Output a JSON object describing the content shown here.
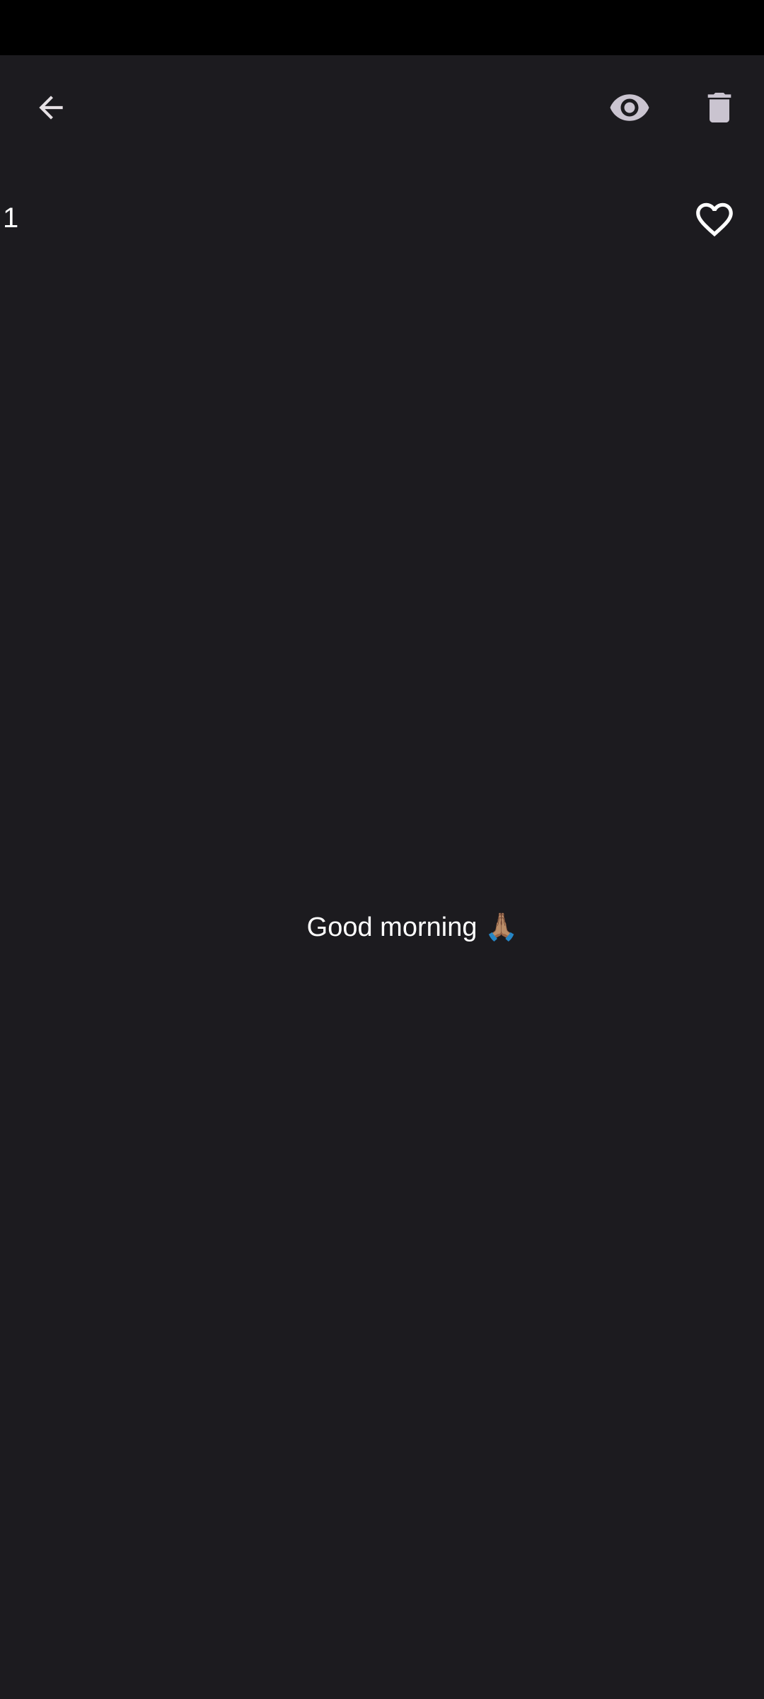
{
  "status_bar": {},
  "toolbar": {
    "back_icon": "arrow-left-icon",
    "view_icon": "eye-icon",
    "delete_icon": "trash-icon"
  },
  "story": {
    "view_count": "1",
    "like_icon": "heart-outline-icon",
    "message": "Good morning 🙏🏽"
  },
  "colors": {
    "background": "#1c1b1f",
    "status_bar": "#000000",
    "icon_light": "#e6e1e5",
    "text": "#ffffff"
  }
}
